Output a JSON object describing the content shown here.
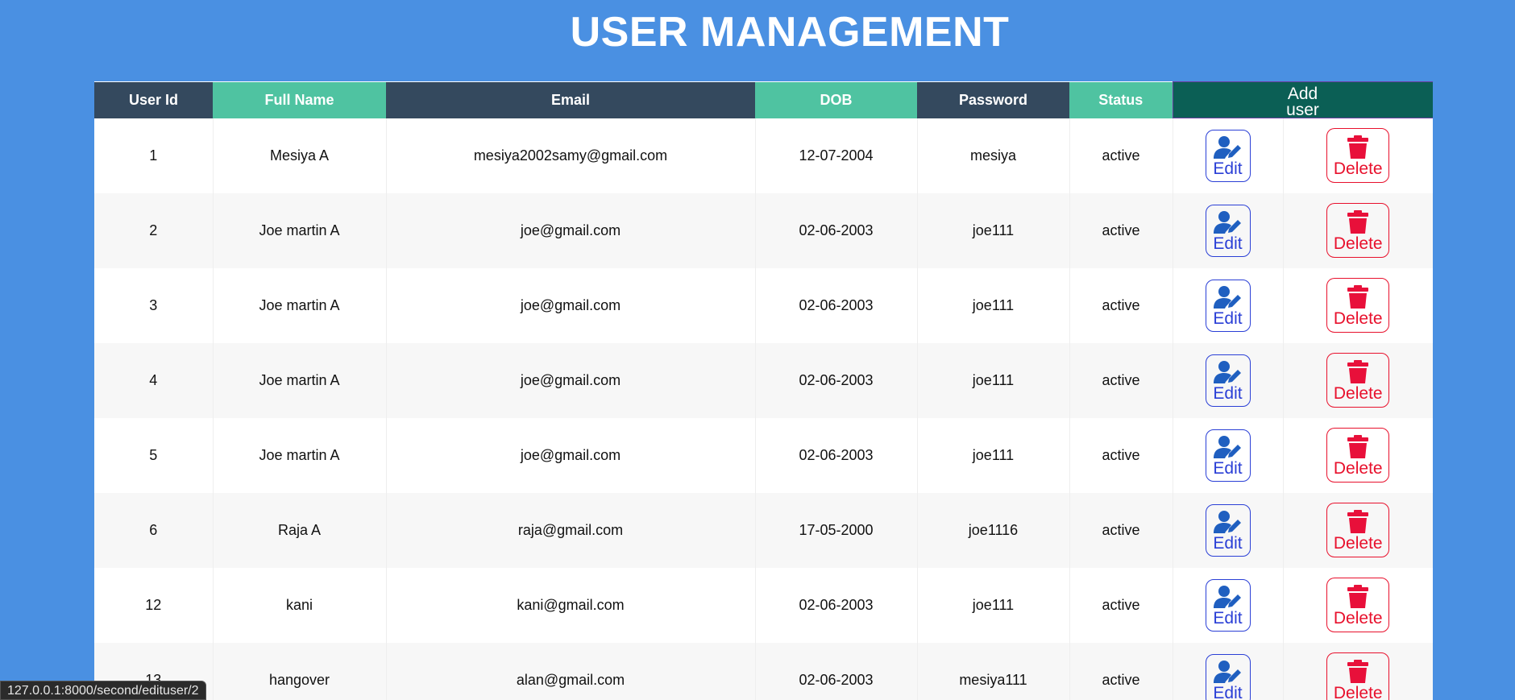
{
  "page": {
    "title": "USER MANAGEMENT"
  },
  "table": {
    "headers": {
      "user_id": "User Id",
      "full_name": "Full Name",
      "email": "Email",
      "dob": "DOB",
      "password": "Password",
      "status": "Status",
      "add_user": "Add user"
    },
    "edit_label": "Edit",
    "delete_label": "Delete",
    "rows": [
      {
        "id": "1",
        "name": "Mesiya A",
        "email": "mesiya2002samy@gmail.com",
        "dob": "12-07-2004",
        "password": "mesiya",
        "status": "active"
      },
      {
        "id": "2",
        "name": "Joe martin A",
        "email": "joe@gmail.com",
        "dob": "02-06-2003",
        "password": "joe111",
        "status": "active"
      },
      {
        "id": "3",
        "name": "Joe martin A",
        "email": "joe@gmail.com",
        "dob": "02-06-2003",
        "password": "joe111",
        "status": "active"
      },
      {
        "id": "4",
        "name": "Joe martin A",
        "email": "joe@gmail.com",
        "dob": "02-06-2003",
        "password": "joe111",
        "status": "active"
      },
      {
        "id": "5",
        "name": "Joe martin A",
        "email": "joe@gmail.com",
        "dob": "02-06-2003",
        "password": "joe111",
        "status": "active"
      },
      {
        "id": "6",
        "name": "Raja A",
        "email": "raja@gmail.com",
        "dob": "17-05-2000",
        "password": "joe1116",
        "status": "active"
      },
      {
        "id": "12",
        "name": "kani",
        "email": "kani@gmail.com",
        "dob": "02-06-2003",
        "password": "joe111",
        "status": "active"
      },
      {
        "id": "13",
        "name": "hangover",
        "email": "alan@gmail.com",
        "dob": "02-06-2003",
        "password": "mesiya111",
        "status": "active"
      }
    ]
  },
  "status_bar": {
    "url": "127.0.0.1:8000/second/edituser/2"
  },
  "colors": {
    "background": "#4a90e2",
    "header_dark": "#34495e",
    "header_teal": "#4fc3a1",
    "add_user_bg": "#0b5f55",
    "edit": "#2a3fd6",
    "delete": "#e8102c"
  },
  "icons": {
    "edit": "user-edit-icon",
    "delete": "trash-icon"
  }
}
